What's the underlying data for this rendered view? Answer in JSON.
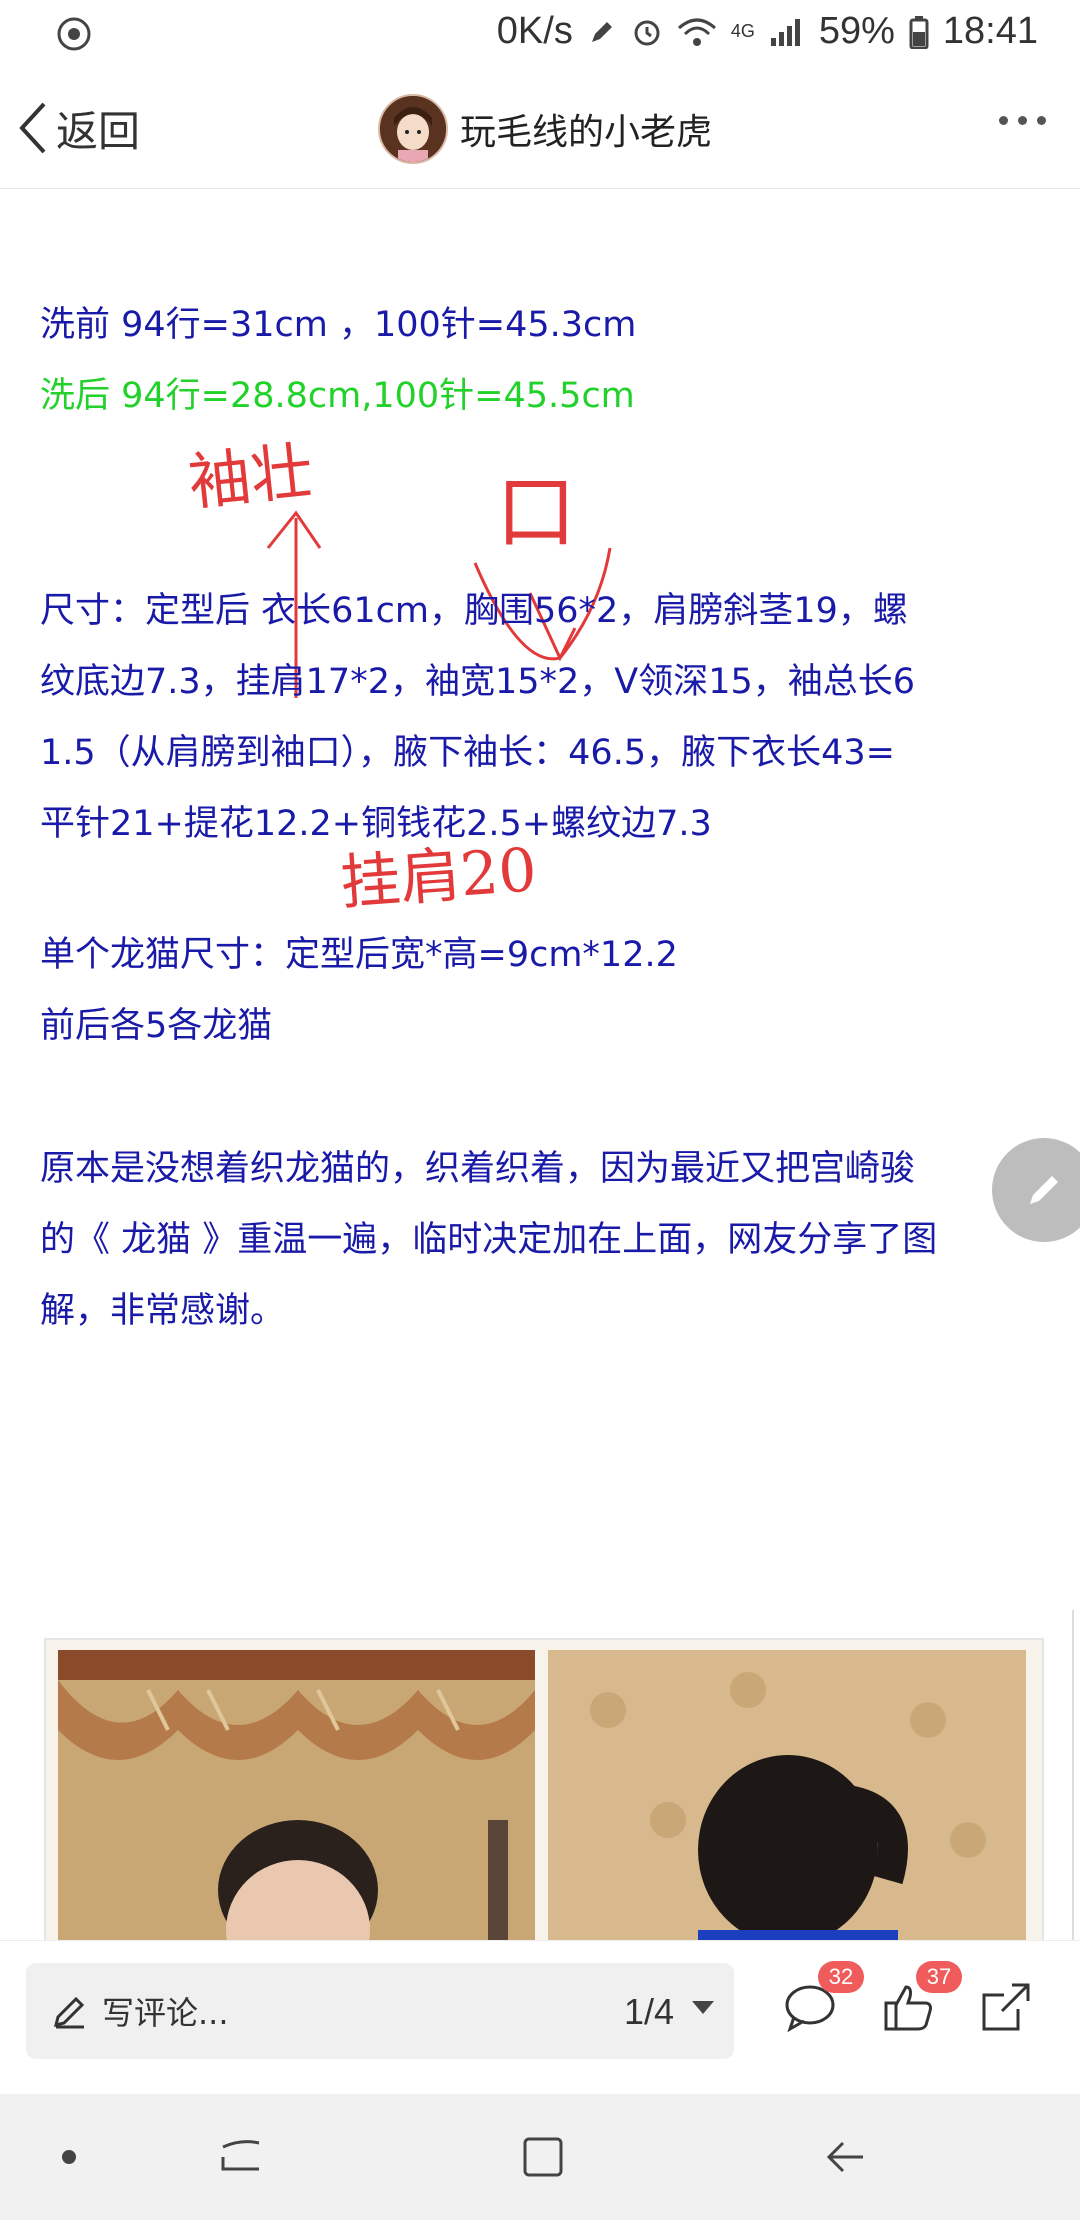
{
  "status_bar": {
    "speed": "0K/s",
    "network": "4G",
    "battery": "59%",
    "time": "18:41",
    "icons": [
      "app-status-icon",
      "edit-icon",
      "alarm-icon",
      "wifi-icon",
      "signal-icon",
      "battery-icon"
    ]
  },
  "header": {
    "back_label": "返回",
    "title": "玩毛线的小老虎",
    "more_icon": "more-icon"
  },
  "article": {
    "line1": "洗前 94行=31cm ，100针=45.3cm",
    "line2": "洗后 94行=28.8cm,100针=45.5cm",
    "size_lines": [
      "尺寸：定型后 衣长61cm，胸围56*2，肩膀斜茎19，螺",
      "纹底边7.3，挂肩17*2，袖宽15*2，V领深15，袖总长6",
      "1.5（从肩膀到袖口），腋下袖长：46.5，腋下衣长43=",
      "平针21+提花12.2+铜钱花2.5+螺纹边7.3"
    ],
    "cat_size": "单个龙猫尺寸：定型后宽*高=9cm*12.2",
    "cat_count": "前后各5各龙猫",
    "story_lines": [
      "原本是没想着织龙猫的，织着织着，因为最近又把宫崎骏",
      "的《 龙猫 》重温一遍，临时决定加在上面，网友分享了图",
      "解，非常感谢。"
    ],
    "handwriting": {
      "note1": "袖壮",
      "note2": "口",
      "note3": "挂肩20"
    }
  },
  "bottom_bar": {
    "comment_placeholder": "写评论...",
    "page_indicator": "1/4",
    "comment_count": "32",
    "like_count": "37"
  },
  "colors": {
    "text_blue": "#1a1aa8",
    "text_green": "#22d12a",
    "annotation_red": "#e23a3a",
    "badge_red": "#f05b5b"
  }
}
